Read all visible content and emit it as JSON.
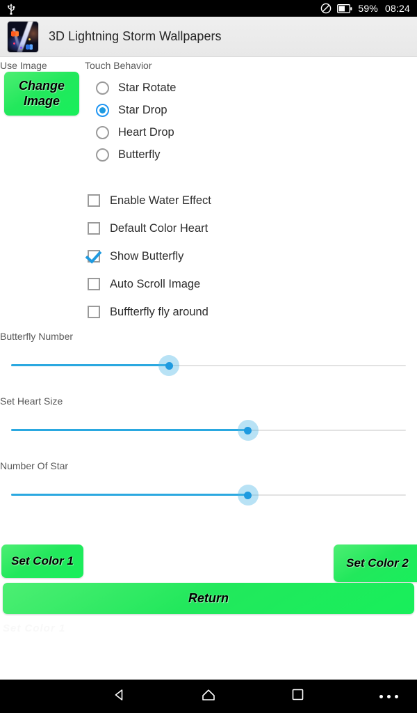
{
  "status_bar": {
    "usb_icon": "usb-icon",
    "dnd_icon": "do-not-disturb-icon",
    "battery_icon": "battery-icon",
    "battery_percent": "59%",
    "clock": "08:24"
  },
  "header": {
    "app_icon": "app-icon-lightning-storm",
    "title": "3D Lightning Storm Wallpapers"
  },
  "settings": {
    "use_image_label": "Use Image",
    "change_image_button": {
      "line1": "Change",
      "line2": "Image"
    },
    "touch_behavior_label": "Touch Behavior",
    "touch_behavior_options": [
      {
        "label": "Star Rotate",
        "selected": false
      },
      {
        "label": "Star Drop",
        "selected": true
      },
      {
        "label": "Heart Drop",
        "selected": false
      },
      {
        "label": "Butterfly",
        "selected": false
      }
    ],
    "checkboxes": [
      {
        "label": "Enable Water Effect",
        "checked": false
      },
      {
        "label": "Default Color Heart",
        "checked": false
      },
      {
        "label": "Show Butterfly",
        "checked": true
      },
      {
        "label": "Auto Scroll Image",
        "checked": false
      },
      {
        "label": "Buffterfly fly around",
        "checked": false
      }
    ],
    "sliders": [
      {
        "label": "Butterfly Number",
        "percent": 40
      },
      {
        "label": "Set Heart Size",
        "percent": 60
      },
      {
        "label": "Number Of Star",
        "percent": 60
      }
    ],
    "set_color_1_button": "Set Color 1",
    "set_color_2_button": "Set Color 2",
    "return_button": "Return",
    "ghost_text": "Set Color 1"
  },
  "nav_bar": {
    "back_icon": "back-triangle-icon",
    "home_icon": "home-icon",
    "recents_icon": "recents-square-icon",
    "menu_icon": "overflow-menu-icon"
  },
  "colors": {
    "accent_blue": "#1e9ae0",
    "button_green": "#22e85c",
    "status_bar_bg": "#000000",
    "header_bg": "#ececec"
  }
}
